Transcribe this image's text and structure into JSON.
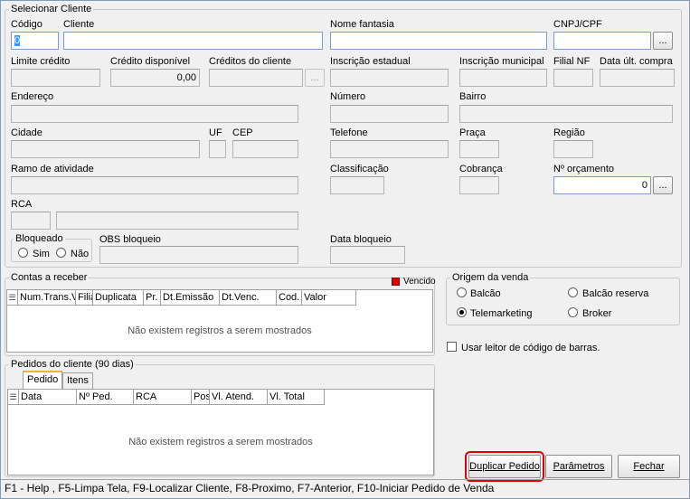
{
  "select_client": {
    "legend": "Selecionar Cliente",
    "codigo_label": "Código",
    "codigo_value": "0",
    "cliente_label": "Cliente",
    "cliente_value": "",
    "nome_fantasia_label": "Nome fantasia",
    "cnpj_label": "CNPJ/CPF",
    "ellipsis": "...",
    "limite_credito_label": "Limite crédito",
    "credito_disponivel_label": "Crédito disponível",
    "credito_disponivel_value": "0,00",
    "creditos_cliente_label": "Créditos do cliente",
    "inscricao_estadual_label": "Inscrição estadual",
    "inscricao_municipal_label": "Inscrição municipal",
    "filial_nf_label": "Filial NF",
    "data_ult_compra_label": "Data últ. compra",
    "endereco_label": "Endereço",
    "numero_label": "Número",
    "bairro_label": "Bairro",
    "cidade_label": "Cidade",
    "uf_label": "UF",
    "cep_label": "CEP",
    "telefone_label": "Telefone",
    "praca_label": "Praça",
    "regiao_label": "Região",
    "ramo_label": "Ramo de atividade",
    "classificacao_label": "Classificação",
    "cobranca_label": "Cobrança",
    "orcamento_label": "Nº orçamento",
    "orcamento_value": "0",
    "rca_label": "RCA",
    "bloqueado_legend": "Bloqueado",
    "sim_label": "Sim",
    "nao_label": "Não",
    "obs_bloqueio_label": "OBS bloqueio",
    "data_bloqueio_label": "Data bloqueio"
  },
  "contas": {
    "legend": "Contas a receber",
    "vencido_label": "Vencido",
    "columns": [
      "Num.Trans.V",
      "Filia",
      "Duplicata",
      "Pr.",
      "Dt.Emissão",
      "Dt.Venc.",
      "Cod.",
      "Valor"
    ],
    "empty_text": "Não existem registros a serem mostrados"
  },
  "origem": {
    "legend": "Origem da venda",
    "balcao": "Balcão",
    "balcao_reserva": "Balcão reserva",
    "telemarketing": "Telemarketing",
    "broker": "Broker",
    "selected": "telemarketing"
  },
  "leitor": {
    "label": "Usar leitor de código de barras."
  },
  "pedidos": {
    "legend": "Pedidos do cliente (90 dias)",
    "tabs": [
      "Pedido",
      "Itens"
    ],
    "columns": [
      "Data",
      "Nº Ped.",
      "RCA",
      "Pos",
      "Vl. Atend.",
      "Vl. Total"
    ],
    "empty_text": "Não existem registros a serem mostrados"
  },
  "buttons": {
    "duplicar": "Duplicar Pedido",
    "parametros": "Parâmetros",
    "fechar": "Fechar"
  },
  "status_bar": "F1 - Help , F5-Limpa Tela, F9-Localizar Cliente, F8-Proximo, F7-Anterior, F10-Iniciar Pedido de Venda",
  "colors": {
    "accent_red": "#e00000",
    "input_border": "#7a9cc8"
  }
}
